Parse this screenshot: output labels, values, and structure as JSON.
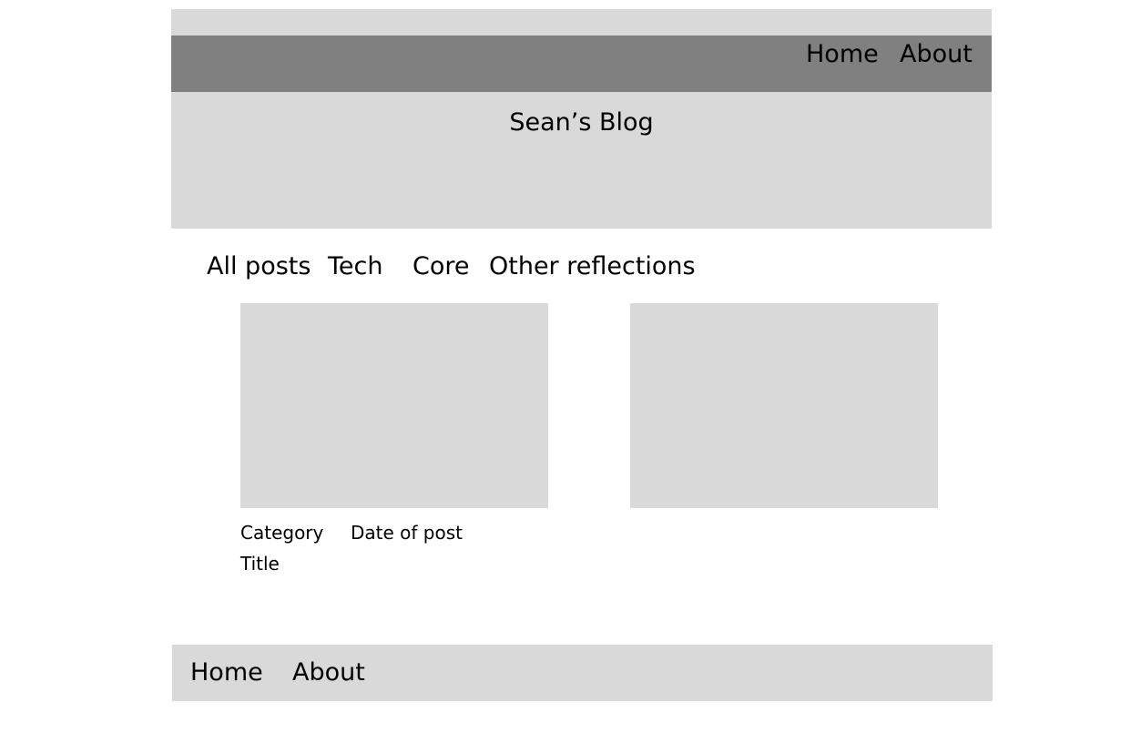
{
  "header": {
    "nav": {
      "home_label": "Home",
      "about_label": "About"
    },
    "blog_title": "Sean’s Blog"
  },
  "tabs": [
    {
      "label": "All posts"
    },
    {
      "label": "Tech"
    },
    {
      "label": "Core"
    },
    {
      "label": "Other reflections"
    }
  ],
  "posts": [
    {
      "category": "Category",
      "date": "Date of post",
      "title": "Title"
    }
  ],
  "footer": {
    "home_label": "Home",
    "about_label": "About"
  },
  "colors": {
    "placeholder_gray": "#d9d9d9",
    "nav_bar_gray": "#808080",
    "text": "#000000",
    "background": "#ffffff"
  }
}
